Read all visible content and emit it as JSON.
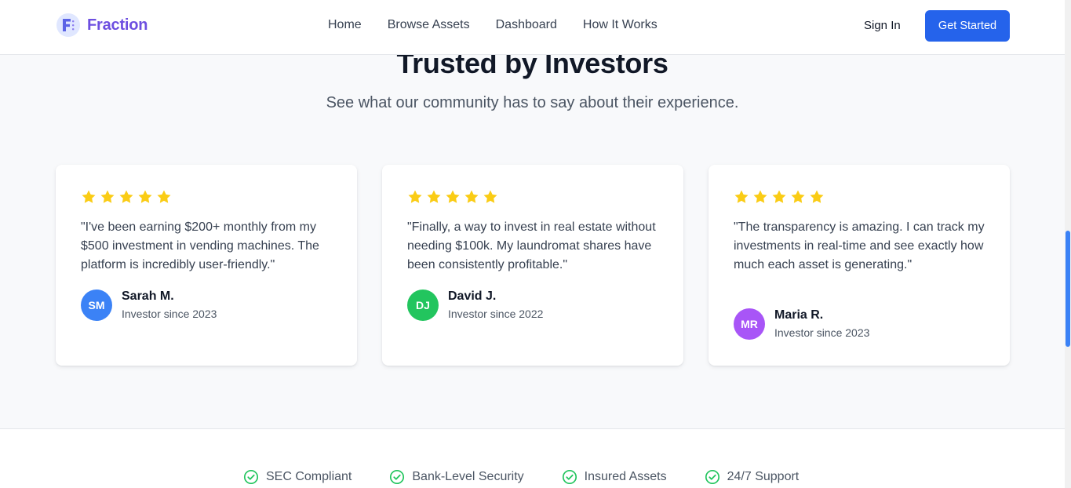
{
  "brand": {
    "name": "Fraction",
    "logo_letter": "F",
    "color": "#6d4fe0"
  },
  "nav": {
    "items": [
      "Home",
      "Browse Assets",
      "Dashboard",
      "How It Works"
    ]
  },
  "auth": {
    "sign_in": "Sign In",
    "get_started": "Get Started"
  },
  "section": {
    "title": "Trusted by Investors",
    "subtitle": "See what our community has to say about their experience."
  },
  "testimonials": [
    {
      "rating": 5,
      "quote": "\"I've been earning $200+ monthly from my $500 investment in vending machines. The platform is incredibly user-friendly.\"",
      "initials": "SM",
      "name": "Sarah M.",
      "since": "Investor since 2023",
      "avatar_color": "#3b82f6"
    },
    {
      "rating": 5,
      "quote": "\"Finally, a way to invest in real estate without needing $100k. My laundromat shares have been consistently profitable.\"",
      "initials": "DJ",
      "name": "David J.",
      "since": "Investor since 2022",
      "avatar_color": "#22c55e"
    },
    {
      "rating": 5,
      "quote": "\"The transparency is amazing. I can track my investments in real-time and see exactly how much each asset is generating.\"",
      "initials": "MR",
      "name": "Maria R.",
      "since": "Investor since 2023",
      "avatar_color": "#a855f7"
    }
  ],
  "trust_badges": [
    "SEC Compliant",
    "Bank-Level Security",
    "Insured Assets",
    "24/7 Support"
  ],
  "colors": {
    "accent": "#2563eb",
    "star": "#facc15",
    "check": "#22c55e"
  }
}
